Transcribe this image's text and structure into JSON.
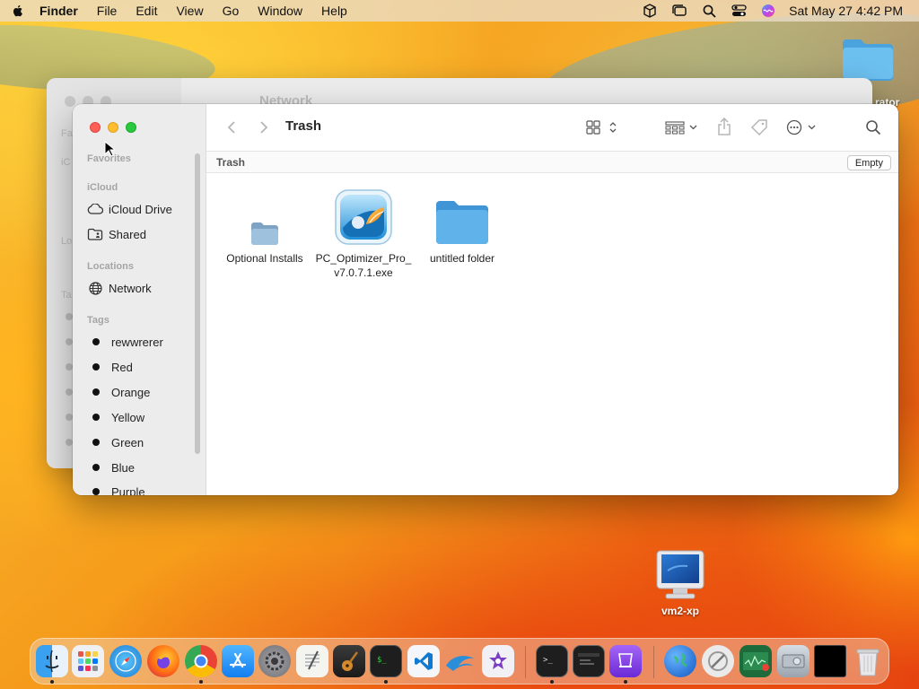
{
  "menubar": {
    "app_name": "Finder",
    "items": [
      "File",
      "Edit",
      "View",
      "Go",
      "Window",
      "Help"
    ],
    "clock": "Sat May 27  4:42 PM"
  },
  "background_window": {
    "title": "Network",
    "sidebar_fragments": [
      "Fa",
      "iC",
      "Lo",
      "Ta"
    ]
  },
  "finder": {
    "title": "Trash",
    "path_label": "Trash",
    "empty_button": "Empty",
    "sidebar": {
      "favorites_header": "Favorites",
      "icloud_header": "iCloud",
      "icloud_items": [
        {
          "label": "iCloud Drive",
          "icon": "cloud-icon"
        },
        {
          "label": "Shared",
          "icon": "shared-folder-icon"
        }
      ],
      "locations_header": "Locations",
      "locations_items": [
        {
          "label": "Network",
          "icon": "globe-icon"
        }
      ],
      "tags_header": "Tags",
      "tags": [
        "rewwrerer",
        "Red",
        "Orange",
        "Yellow",
        "Green",
        "Blue",
        "Purple"
      ]
    },
    "files": [
      {
        "name": "Optional Installs",
        "icon": "small-folder-icon"
      },
      {
        "name": "PC_Optimizer_Pro_v7.0.7.1.exe",
        "icon": "pc-optimizer-app-icon"
      },
      {
        "name": "untitled folder",
        "icon": "folder-icon"
      }
    ]
  },
  "desktop": {
    "vm_label": "vm2-xp",
    "folder_label_fragment": "rator"
  },
  "dock": {
    "apps": [
      "Finder",
      "Launchpad",
      "Safari",
      "Firefox",
      "Chrome",
      "App Store",
      "System Settings",
      "TextEdit",
      "GarageBand",
      "Terminal",
      "Visual Studio Code",
      "Wireshark",
      "iMovie",
      "Terminal",
      "Console",
      "Simulator",
      "Network Utility",
      "Directory Utility",
      "Activity Monitor",
      "Disk Utility",
      "Black Window",
      "Trash"
    ]
  },
  "colors": {
    "close": "#ff5f57",
    "minimize": "#febc2e",
    "maximize": "#28c840",
    "folder_blue": "#5fb3ea"
  }
}
